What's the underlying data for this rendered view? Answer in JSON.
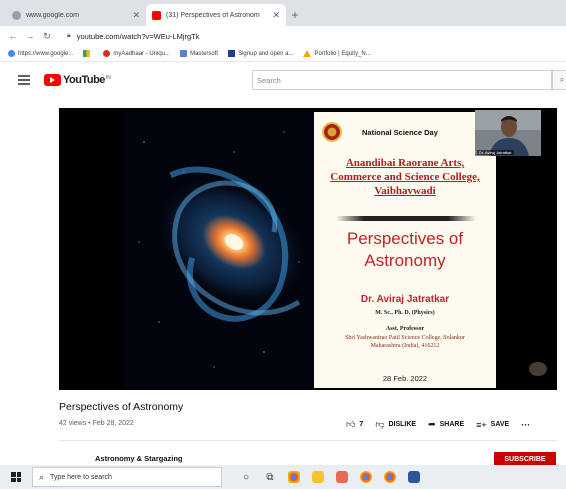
{
  "browser": {
    "tabs": [
      {
        "title": "www.google.com",
        "active": false
      },
      {
        "title": "(31) Perspectives of Astronom",
        "active": true
      }
    ],
    "url": "youtube.com/watch?v=WEu-LMjrgTk",
    "bookmarks": [
      {
        "label": "https://www.google..."
      },
      {
        "label": "myAadhaar - Uniqu..."
      },
      {
        "label": "Mastersoft"
      },
      {
        "label": "Signup and open a..."
      },
      {
        "label": "Portfolio | Equity_N..."
      }
    ]
  },
  "youtube": {
    "logo_text": "YouTube",
    "country_code": "IN",
    "search_placeholder": "Search"
  },
  "slide": {
    "event": "National Science Day",
    "college_lines": [
      "Anandibai Raorane Arts,",
      "Commerce and Science College,",
      "Vaibhavwadi"
    ],
    "topic_lines": [
      "Perspectives of",
      "Astronomy"
    ],
    "speaker": "Dr. Aviraj Jatratkar",
    "qualification": "M. Sc., Ph. D. (Physics)",
    "designation": "Asst. Professor",
    "institute_lines": [
      "Shri Yashwantrao Patil Science College, Solankur",
      "Maharashtra (India), 416212"
    ],
    "date": "28 Feb. 2022",
    "camera_label": "Dr. Aviraj Jatratkar"
  },
  "video": {
    "title": "Perspectives of Astronomy",
    "meta": "42 views • Feb 28, 2022",
    "likes": "7",
    "dislike_label": "DISLIKE",
    "share_label": "SHARE",
    "save_label": "SAVE",
    "channel": "Astronomy & Stargazing",
    "subscribe_label": "SUBSCRIBE"
  },
  "taskbar": {
    "search_placeholder": "Type here to search"
  },
  "colors": {
    "youtube_red": "#ff0000",
    "subscribe_red": "#cc0000",
    "slide_red": "#c0232a"
  }
}
